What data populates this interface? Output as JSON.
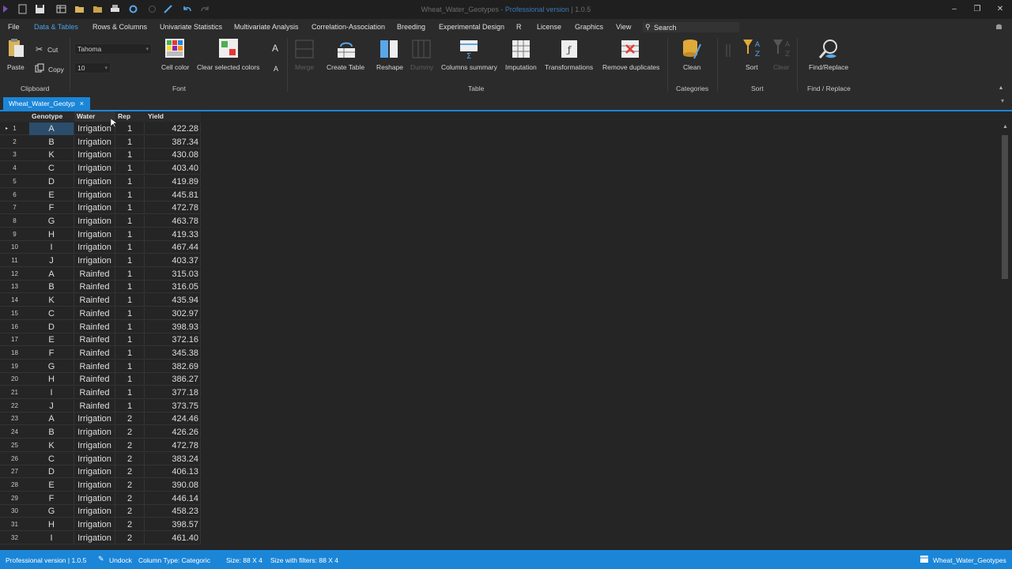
{
  "window": {
    "title": "Wheat_Water_Geotypes",
    "title_suffix": "Professional version",
    "version": "1.0.5",
    "controls": {
      "minimize": "–",
      "maximize": "❐",
      "close": "✕"
    }
  },
  "menu": {
    "items": [
      "File",
      "Data & Tables",
      "Rows & Columns",
      "Univariate Statistics",
      "Multivariate Analysis",
      "Correlation-Association",
      "Breeding",
      "Experimental Design",
      "R",
      "License",
      "Graphics",
      "View"
    ],
    "active": "Data & Tables",
    "search_label": "Search",
    "search_icon_glyph": "⚲"
  },
  "ribbon": {
    "paste": "Paste",
    "cut": "Cut",
    "copy": "Copy",
    "font_name": "Tahoma",
    "font_size": "10",
    "grow_glyph": "A",
    "cell_color": "Cell color",
    "clear_colors": "Clear selected colors",
    "merge": "Merge",
    "create_table": "Create Table",
    "reshape": "Reshape",
    "dummy": "Dummy",
    "columns_summary": "Columns summary",
    "imputation": "Imputation",
    "transformations": "Transformations",
    "remove_duplicates": "Remove duplicates",
    "clean": "Clean",
    "sort": "Sort",
    "clear": "Clear",
    "find_replace": "Find/Replace",
    "groups": {
      "clipboard": "Clipboard",
      "font": "Font",
      "table": "Table",
      "categories": "Categories",
      "sort": "Sort",
      "find_replace": "Find / Replace"
    }
  },
  "doc_tab": {
    "label": "Wheat_Water_Geotyp",
    "close": "×"
  },
  "grid": {
    "columns": [
      "Genotype",
      "Water",
      "Rep",
      "Yield"
    ],
    "rows": [
      [
        "1",
        "A",
        "Irrigation",
        "1",
        "422.28"
      ],
      [
        "2",
        "B",
        "Irrigation",
        "1",
        "387.34"
      ],
      [
        "3",
        "K",
        "Irrigation",
        "1",
        "430.08"
      ],
      [
        "4",
        "C",
        "Irrigation",
        "1",
        "403.40"
      ],
      [
        "5",
        "D",
        "Irrigation",
        "1",
        "419.89"
      ],
      [
        "6",
        "E",
        "Irrigation",
        "1",
        "445.81"
      ],
      [
        "7",
        "F",
        "Irrigation",
        "1",
        "472.78"
      ],
      [
        "8",
        "G",
        "Irrigation",
        "1",
        "463.78"
      ],
      [
        "9",
        "H",
        "Irrigation",
        "1",
        "419.33"
      ],
      [
        "10",
        "I",
        "Irrigation",
        "1",
        "467.44"
      ],
      [
        "11",
        "J",
        "Irrigation",
        "1",
        "403.37"
      ],
      [
        "12",
        "A",
        "Rainfed",
        "1",
        "315.03"
      ],
      [
        "13",
        "B",
        "Rainfed",
        "1",
        "316.05"
      ],
      [
        "14",
        "K",
        "Rainfed",
        "1",
        "435.94"
      ],
      [
        "15",
        "C",
        "Rainfed",
        "1",
        "302.97"
      ],
      [
        "16",
        "D",
        "Rainfed",
        "1",
        "398.93"
      ],
      [
        "17",
        "E",
        "Rainfed",
        "1",
        "372.16"
      ],
      [
        "18",
        "F",
        "Rainfed",
        "1",
        "345.38"
      ],
      [
        "19",
        "G",
        "Rainfed",
        "1",
        "382.69"
      ],
      [
        "20",
        "H",
        "Rainfed",
        "1",
        "386.27"
      ],
      [
        "21",
        "I",
        "Rainfed",
        "1",
        "377.18"
      ],
      [
        "22",
        "J",
        "Rainfed",
        "1",
        "373.75"
      ],
      [
        "23",
        "A",
        "Irrigation",
        "2",
        "424.46"
      ],
      [
        "24",
        "B",
        "Irrigation",
        "2",
        "426.26"
      ],
      [
        "25",
        "K",
        "Irrigation",
        "2",
        "472.78"
      ],
      [
        "26",
        "C",
        "Irrigation",
        "2",
        "383.24"
      ],
      [
        "27",
        "D",
        "Irrigation",
        "2",
        "406.13"
      ],
      [
        "28",
        "E",
        "Irrigation",
        "2",
        "390.08"
      ],
      [
        "29",
        "F",
        "Irrigation",
        "2",
        "446.14"
      ],
      [
        "30",
        "G",
        "Irrigation",
        "2",
        "458.23"
      ],
      [
        "31",
        "H",
        "Irrigation",
        "2",
        "398.57"
      ],
      [
        "32",
        "I",
        "Irrigation",
        "2",
        "461.40"
      ]
    ]
  },
  "status": {
    "version": "Professional version | 1.0.5",
    "undock": "Undock",
    "column_type": "Column Type: Categoric",
    "size": "Size: 88 X 4",
    "size_filters": "Size with filters: 88 X 4",
    "file": "Wheat_Water_Geotypes"
  },
  "colors": {
    "accent": "#1b86d8",
    "background": "#252526",
    "ribbon": "#2b2b2b"
  }
}
